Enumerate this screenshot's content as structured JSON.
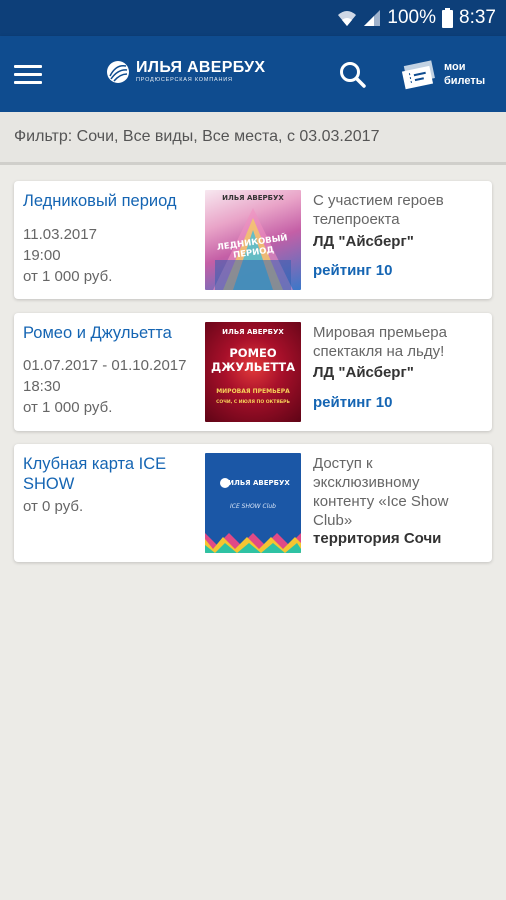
{
  "status_bar": {
    "battery": "100%",
    "time": "8:37",
    "icons": [
      "wifi-icon",
      "signal-icon",
      "battery-icon"
    ]
  },
  "app_bar": {
    "menu_icon": "menu-icon",
    "logo_name": "ИЛЬЯ АВЕРБУХ",
    "logo_sub": "ПРОДЮСЕРСКАЯ КОМПАНИЯ",
    "search_icon": "search-icon",
    "tickets_label_line1": "мои",
    "tickets_label_line2": "билеты"
  },
  "filter": {
    "text": "Фильтр: Сочи, Все виды, Все места, с 03.03.2017"
  },
  "events": [
    {
      "title": "Ледниковый период",
      "date": "11.03.2017",
      "time": "19:00",
      "price": "от 1 000 руб.",
      "description": "С участием героев телепроекта",
      "venue": "ЛД \"Айсберг\"",
      "rating": "рейтинг 10",
      "thumb_brand": "ИЛЬЯ АВЕРБУХ",
      "thumb_caption": "ЛЕДНИКОВЫЙ ПЕРИОД"
    },
    {
      "title": "Ромео и Джульетта",
      "date": "01.07.2017 - 01.10.2017",
      "time": "18:30",
      "price": "от 1 000 руб.",
      "description": "Мировая премьера спектакля на льду!",
      "venue": "ЛД \"Айсберг\"",
      "rating": "рейтинг 10",
      "thumb_brand": "ИЛЬЯ АВЕРБУХ",
      "thumb_title": "РОМЕО ДЖУЛЬЕТТА",
      "thumb_caption": "МИРОВАЯ ПРЕМЬЕРА",
      "thumb_sub": "СОЧИ, С ИЮЛЯ ПО ОКТЯБРЬ"
    },
    {
      "title": "Клубная карта ICE SHOW",
      "price": "от 0 руб.",
      "description": "Доступ к эксклюзивному контенту «Ice Show Club»",
      "venue": "территория Сочи",
      "thumb_brand": "ИЛЬЯ АВЕРБУХ",
      "thumb_caption": "ICE SHOW Club"
    }
  ],
  "colors": {
    "app_bar": "#0f4c8f",
    "status_bar": "#0d3f79",
    "link": "#1565b3",
    "background": "#ecebe7"
  }
}
